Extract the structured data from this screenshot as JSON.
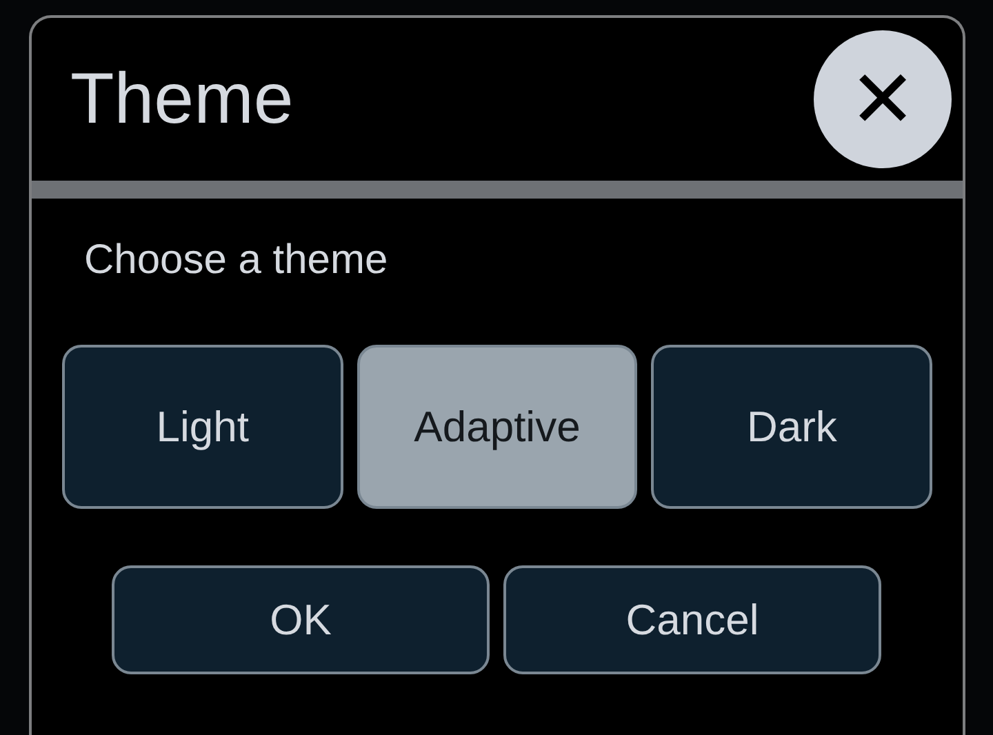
{
  "dialog": {
    "title": "Theme",
    "close_label": "✕"
  },
  "prompt": "Choose a theme",
  "themes": [
    {
      "label": "Light",
      "selected": false
    },
    {
      "label": "Adaptive",
      "selected": true
    },
    {
      "label": "Dark",
      "selected": false
    }
  ],
  "buttons": [
    "OK",
    "Cancel"
  ]
}
